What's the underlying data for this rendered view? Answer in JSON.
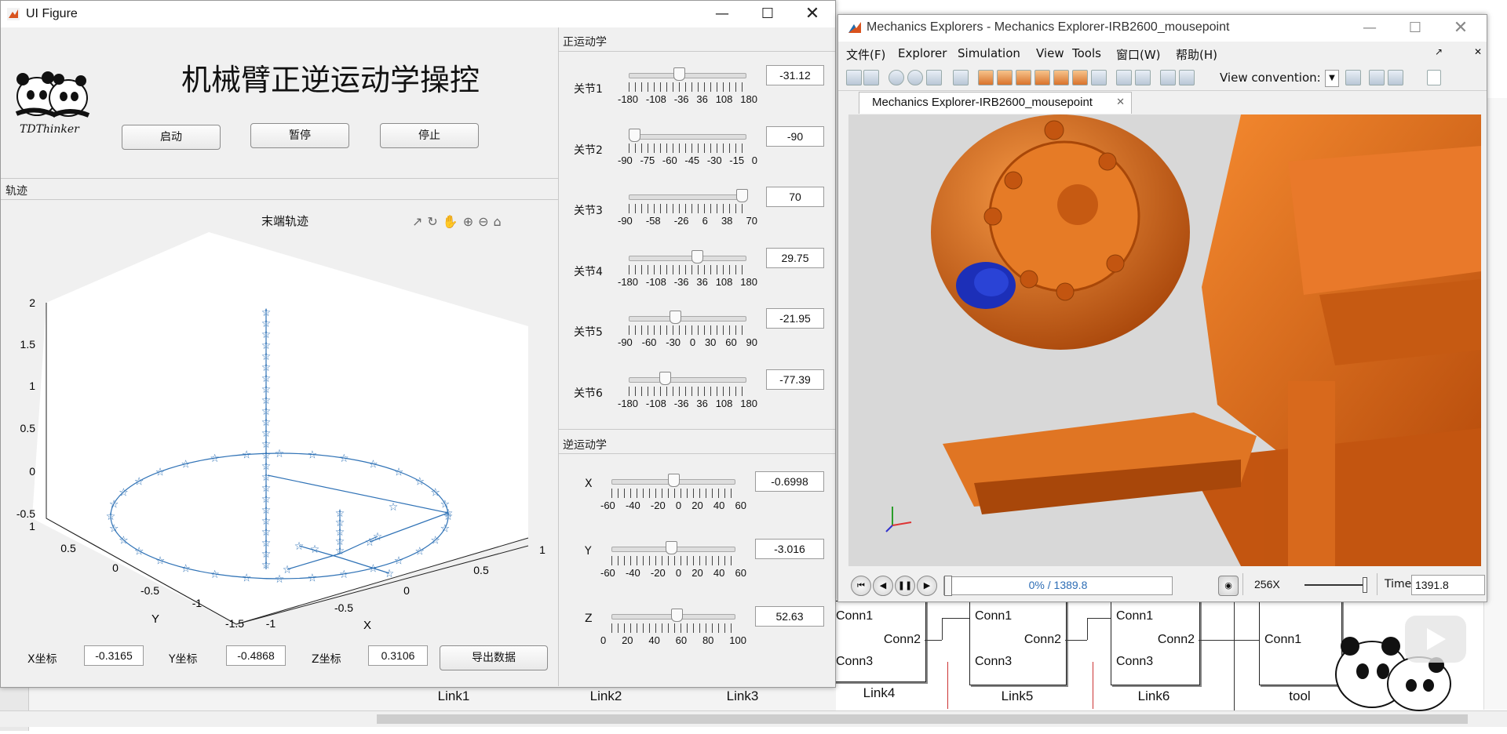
{
  "ui_figure": {
    "window_title": "UI Figure",
    "app_title": "机械臂正逆运动学操控",
    "logo_text": "TDThinker",
    "buttons": {
      "start": "启动",
      "pause": "暂停",
      "stop": "停止",
      "export": "导出数据"
    },
    "trajectory_panel": {
      "title": "轨迹",
      "plot_title": "末端轨迹",
      "z_ticks": [
        "2",
        "1.5",
        "1",
        "0.5",
        "0",
        "-0.5"
      ],
      "y_ticks": [
        "1",
        "0.5",
        "0",
        "-0.5",
        "-1",
        "-1.5"
      ],
      "x_ticks": [
        "-1",
        "-0.5",
        "0",
        "0.5",
        "1"
      ],
      "x_axis_label": "X",
      "y_axis_label": "Y"
    },
    "coords": {
      "x_label": "X坐标",
      "x_value": "-0.3165",
      "y_label": "Y坐标",
      "y_value": "-0.4868",
      "z_label": "Z坐标",
      "z_value": "0.3106"
    },
    "forward_panel": {
      "title": "正运动学",
      "joints": [
        {
          "label": "关节1",
          "value": "-31.12",
          "level": 0.414,
          "ticks": [
            "-180",
            "-108",
            "-36",
            "36",
            "108",
            "180"
          ]
        },
        {
          "label": "关节2",
          "value": "-90",
          "level": 0.0,
          "ticks": [
            "-90",
            "-75",
            "-60",
            "-45",
            "-30",
            "-15",
            "0"
          ]
        },
        {
          "label": "关节3",
          "value": "70",
          "level": 1.0,
          "ticks": [
            "-90",
            "-58",
            "-26",
            "6",
            "38",
            "70"
          ]
        },
        {
          "label": "关节4",
          "value": "29.75",
          "level": 0.583,
          "ticks": [
            "-180",
            "-108",
            "-36",
            "36",
            "108",
            "180"
          ]
        },
        {
          "label": "关节5",
          "value": "-21.95",
          "level": 0.378,
          "ticks": [
            "-90",
            "-60",
            "-30",
            "0",
            "30",
            "60",
            "90"
          ]
        },
        {
          "label": "关节6",
          "value": "-77.39",
          "level": 0.285,
          "ticks": [
            "-180",
            "-108",
            "-36",
            "36",
            "108",
            "180"
          ]
        }
      ]
    },
    "inverse_panel": {
      "title": "逆运动学",
      "axes": [
        {
          "label": "X",
          "value": "-0.6998",
          "level": 0.494,
          "ticks": [
            "-60",
            "-40",
            "-20",
            "0",
            "20",
            "40",
            "60"
          ]
        },
        {
          "label": "Y",
          "value": "-3.016",
          "level": 0.475,
          "ticks": [
            "-60",
            "-40",
            "-20",
            "0",
            "20",
            "40",
            "60"
          ]
        },
        {
          "label": "Z",
          "value": "52.63",
          "level": 0.526,
          "ticks": [
            "0",
            "20",
            "40",
            "60",
            "80",
            "100"
          ]
        }
      ]
    }
  },
  "mechanics_explorer": {
    "window_title": "Mechanics Explorers - Mechanics Explorer-IRB2600_mousepoint",
    "menu": [
      "文件(F)",
      "Explorer",
      "Simulation",
      "View",
      "Tools",
      "窗口(W)",
      "帮助(H)"
    ],
    "view_convention_label": "View convention:",
    "tab_label": "Mechanics Explorer-IRB2600_mousepoint",
    "progress_text": "0% / 1389.8",
    "progress_fraction": 0.0,
    "speed_text": "256X",
    "time_label": "Time",
    "time_value": "1391.8"
  },
  "simulink": {
    "blocks": [
      {
        "name": "Link4",
        "ports": [
          "Conn1",
          "Conn2",
          "Conn3"
        ]
      },
      {
        "name": "Link5",
        "ports": [
          "Conn1",
          "Conn2",
          "Conn3"
        ]
      },
      {
        "name": "Link6",
        "ports": [
          "Conn1",
          "Conn2",
          "Conn3"
        ]
      },
      {
        "name": "tool",
        "ports": [
          "Conn1"
        ]
      }
    ],
    "lower_labels": [
      "Link1",
      "Link2",
      "Link3"
    ]
  }
}
